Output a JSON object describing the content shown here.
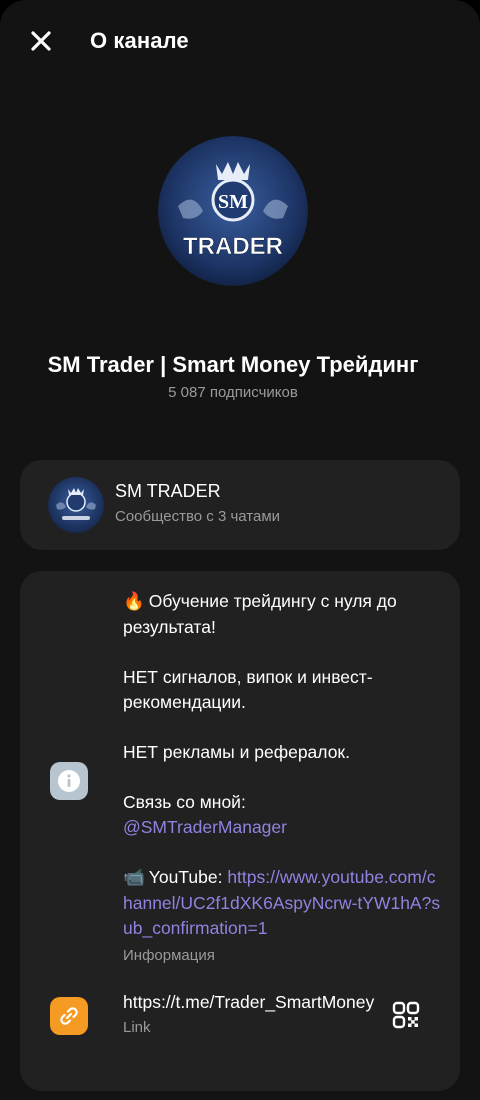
{
  "header": {
    "title": "О канале",
    "close_icon": "close-icon"
  },
  "channel": {
    "name": "SM Trader | Smart Money Трейдинг",
    "subscribers": "5 087 подписчиков",
    "avatar_text_top": "SM",
    "avatar_text_bottom": "TRADER"
  },
  "community": {
    "title": "SM TRADER",
    "subtitle": "Сообщество с 3 чатами"
  },
  "info": {
    "line1_emoji": "🔥",
    "line1": "Обучение трейдингу с нуля до результата!",
    "line2": "НЕТ сигналов, випок и инвест-рекомендации.",
    "line3": "НЕТ рекламы и рефералок.",
    "contact_label": "Связь со мной:",
    "contact_link": "@SMTraderManager",
    "youtube_emoji": "📹",
    "youtube_label": "YouTube:",
    "youtube_link": "https://www.youtube.com/channel/UC2f1dXK6AspyNcrw-tYW1hA?sub_confirmation=1",
    "label": "Информация"
  },
  "link": {
    "url": "https://t.me/Trader_SmartMoney",
    "label": "Link"
  },
  "colors": {
    "background": "#131313",
    "card": "#212121",
    "accent_link": "#8f83e0",
    "info_icon_bg": "#b7c5d0",
    "link_icon_bg": "#f59a22"
  }
}
